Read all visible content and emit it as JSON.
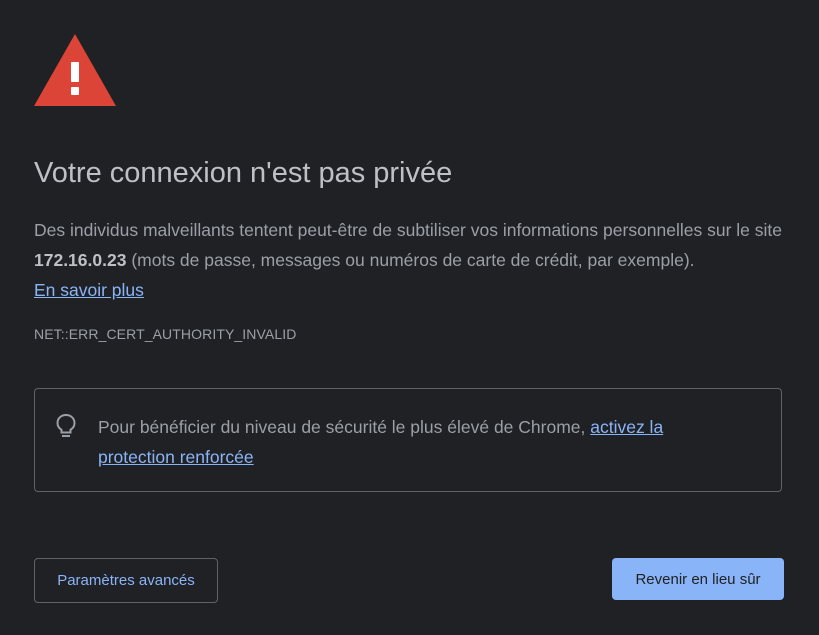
{
  "icons": {
    "warning": "warning-triangle-icon",
    "bulb": "lightbulb-icon"
  },
  "colors": {
    "background": "#202124",
    "warning_red": "#db4437",
    "link": "#8ab4f8",
    "primary_button": "#8ab4f8"
  },
  "heading": {
    "title": "Votre connexion n'est pas privée"
  },
  "explanation": {
    "prefix": "Des individus malveillants tentent peut-être de subtiliser vos informations personnelles sur le site ",
    "host": "172.16.0.23",
    "suffix": " (mots de passe, messages ou numéros de carte de crédit, par exemple).",
    "learn_more": "En savoir plus"
  },
  "error_code": "NET::ERR_CERT_AUTHORITY_INVALID",
  "enhanced_protection": {
    "text": "Pour bénéficier du niveau de sécurité le plus élevé de Chrome, ",
    "link": "activez la protection renforcée"
  },
  "buttons": {
    "advanced": "Paramètres avancés",
    "back_to_safety": "Revenir en lieu sûr"
  }
}
